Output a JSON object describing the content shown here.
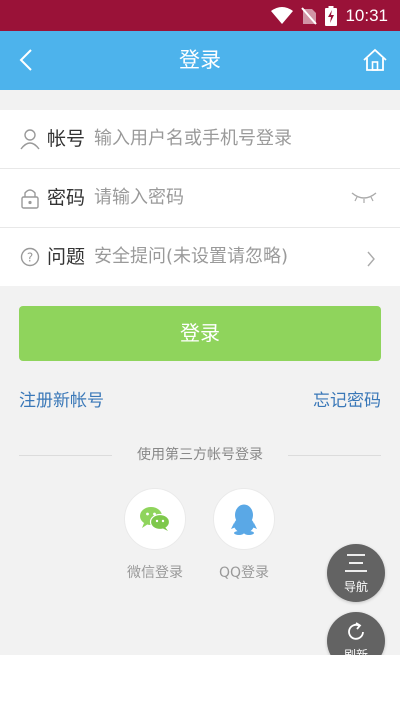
{
  "status_bar": {
    "time": "10:31"
  },
  "header": {
    "title": "登录"
  },
  "form": {
    "account": {
      "label": "帐号",
      "placeholder": "输入用户名或手机号登录"
    },
    "password": {
      "label": "密码",
      "placeholder": "请输入密码"
    },
    "question": {
      "label": "问题",
      "value": "安全提问(未设置请忽略)"
    }
  },
  "login_button": "登录",
  "links": {
    "register": "注册新帐号",
    "forgot": "忘记密码"
  },
  "third_party": {
    "title": "使用第三方帐号登录",
    "wechat": "微信登录",
    "qq": "QQ登录"
  },
  "float_menu": {
    "nav": "导航",
    "refresh": "刷新"
  },
  "colors": {
    "status_bar": "#9a1238",
    "nav_bar": "#4db3ec",
    "login_button": "#8fd45c",
    "link": "#3a78b8"
  }
}
